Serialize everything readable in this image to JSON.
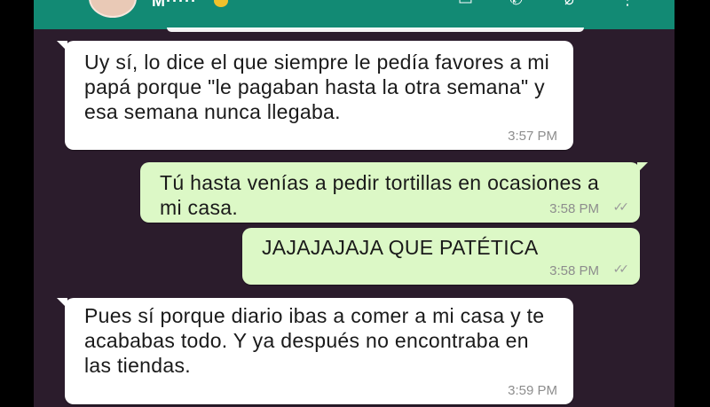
{
  "header": {
    "contact_name": "M·····"
  },
  "messages": [
    {
      "direction": "incoming",
      "text": "Uy sí, lo dice el que siempre le pedía favores a mi papá porque \"le pagaban hasta la otra semana\" y esa semana nunca llegaba.",
      "time": "3:57 PM"
    },
    {
      "direction": "outgoing",
      "text": "Tú hasta venías a pedir tortillas en ocasiones a mi casa.",
      "time": "3:58 PM",
      "status_icon": "double-check-icon"
    },
    {
      "direction": "outgoing",
      "text": "JAJAJAJAJA QUE PATÉTICA",
      "time": "3:58 PM",
      "status_icon": "double-check-icon"
    },
    {
      "direction": "incoming",
      "text": "Pues sí porque diario ibas a comer a mi casa y te acababas todo. Y ya después no encontraba en las tiendas.",
      "time": "3:59 PM"
    }
  ],
  "colors": {
    "chat_background": "#2b1c2c",
    "header": "#128a74",
    "incoming_bubble": "#ffffff",
    "outgoing_bubble": "#dcf8c6"
  }
}
